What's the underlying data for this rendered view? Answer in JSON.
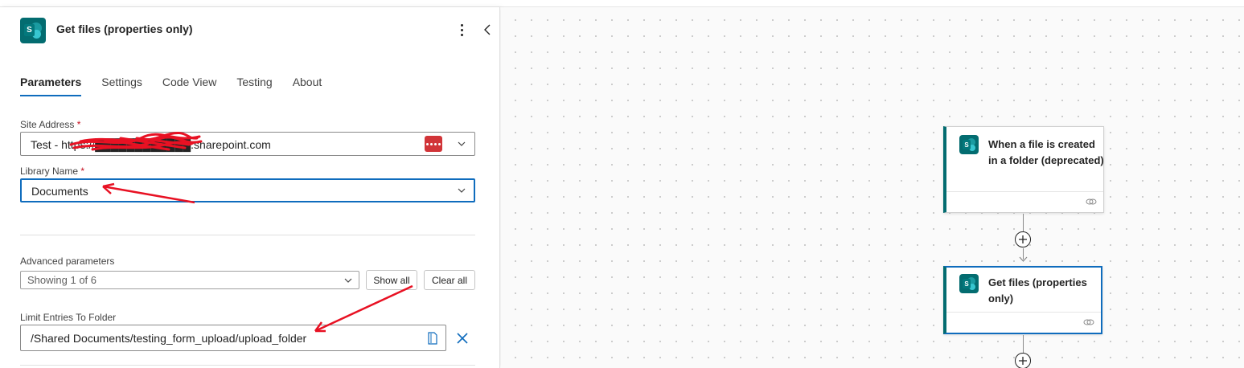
{
  "panel": {
    "title": "Get files (properties only)",
    "tabs": [
      {
        "label": "Parameters"
      },
      {
        "label": "Settings"
      },
      {
        "label": "Code View"
      },
      {
        "label": "Testing"
      },
      {
        "label": "About"
      }
    ],
    "site_address": {
      "label": "Site Address",
      "required_mark": "*",
      "value": "Test - https://████████████.sharepoint.com"
    },
    "library_name": {
      "label": "Library Name",
      "required_mark": "*",
      "value": "Documents"
    },
    "advanced": {
      "label": "Advanced parameters",
      "select_value": "Showing 1 of 6",
      "show_all_label": "Show all",
      "clear_all_label": "Clear all"
    },
    "limit_folder": {
      "label": "Limit Entries To Folder",
      "value": "/Shared Documents/testing_form_upload/upload_folder"
    }
  },
  "canvas": {
    "trigger_card": {
      "title": "When a file is created in a folder (deprecated)"
    },
    "action_card": {
      "title": "Get files (properties only)"
    }
  },
  "colors": {
    "accent": "#0f6cbd",
    "sharepoint": "#036c70",
    "required": "#c50f1f",
    "annotation_red": "#e81123"
  }
}
